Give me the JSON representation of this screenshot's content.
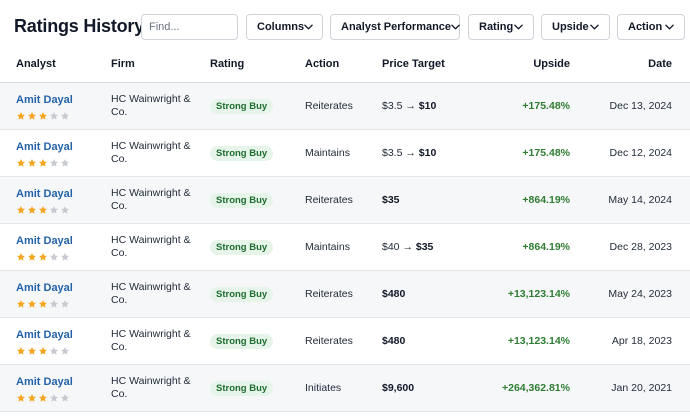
{
  "header": {
    "title": "Ratings History",
    "search_placeholder": "Find...",
    "filters": [
      "Columns",
      "Analyst Performance",
      "Rating",
      "Upside",
      "Action"
    ]
  },
  "columns": [
    "Analyst",
    "Firm",
    "Rating",
    "Action",
    "Price Target",
    "Upside",
    "Date"
  ],
  "colors": {
    "link": "#2563a8",
    "upside": "#2e7d32",
    "badge_bg": "#e6f4ea",
    "badge_text": "#1e6e2f",
    "star_on": "#f5a623",
    "star_off": "#c7cbd1"
  },
  "rows": [
    {
      "analyst": "Amit Dayal",
      "stars": 3,
      "firm": "HC Wainwright & Co.",
      "rating": "Strong Buy",
      "action": "Reiterates",
      "pt_old": "$3.5",
      "pt_new": "$10",
      "upside": "+175.48%",
      "date": "Dec 13, 2024"
    },
    {
      "analyst": "Amit Dayal",
      "stars": 3,
      "firm": "HC Wainwright & Co.",
      "rating": "Strong Buy",
      "action": "Maintains",
      "pt_old": "$3.5",
      "pt_new": "$10",
      "upside": "+175.48%",
      "date": "Dec 12, 2024"
    },
    {
      "analyst": "Amit Dayal",
      "stars": 3,
      "firm": "HC Wainwright & Co.",
      "rating": "Strong Buy",
      "action": "Reiterates",
      "pt_old": "",
      "pt_new": "$35",
      "upside": "+864.19%",
      "date": "May 14, 2024"
    },
    {
      "analyst": "Amit Dayal",
      "stars": 3,
      "firm": "HC Wainwright & Co.",
      "rating": "Strong Buy",
      "action": "Maintains",
      "pt_old": "$40",
      "pt_new": "$35",
      "upside": "+864.19%",
      "date": "Dec 28, 2023"
    },
    {
      "analyst": "Amit Dayal",
      "stars": 3,
      "firm": "HC Wainwright & Co.",
      "rating": "Strong Buy",
      "action": "Reiterates",
      "pt_old": "",
      "pt_new": "$480",
      "upside": "+13,123.14%",
      "date": "May 24, 2023"
    },
    {
      "analyst": "Amit Dayal",
      "stars": 3,
      "firm": "HC Wainwright & Co.",
      "rating": "Strong Buy",
      "action": "Reiterates",
      "pt_old": "",
      "pt_new": "$480",
      "upside": "+13,123.14%",
      "date": "Apr 18, 2023"
    },
    {
      "analyst": "Amit Dayal",
      "stars": 3,
      "firm": "HC Wainwright & Co.",
      "rating": "Strong Buy",
      "action": "Initiates",
      "pt_old": "",
      "pt_new": "$9,600",
      "upside": "+264,362.81%",
      "date": "Jan 20, 2021"
    }
  ]
}
